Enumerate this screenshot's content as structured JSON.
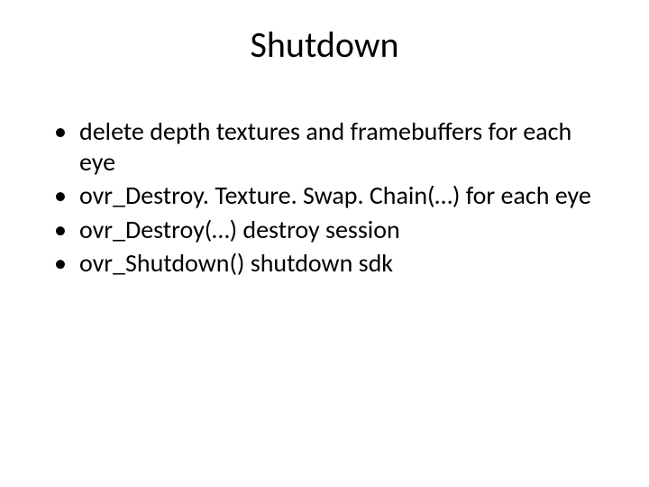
{
  "slide": {
    "title": "Shutdown",
    "bullets": [
      "delete depth textures and framebuffers for each eye",
      "ovr_Destroy. Texture. Swap. Chain(…) for each eye",
      "ovr_Destroy(…) destroy session",
      "ovr_Shutdown() shutdown sdk"
    ]
  }
}
